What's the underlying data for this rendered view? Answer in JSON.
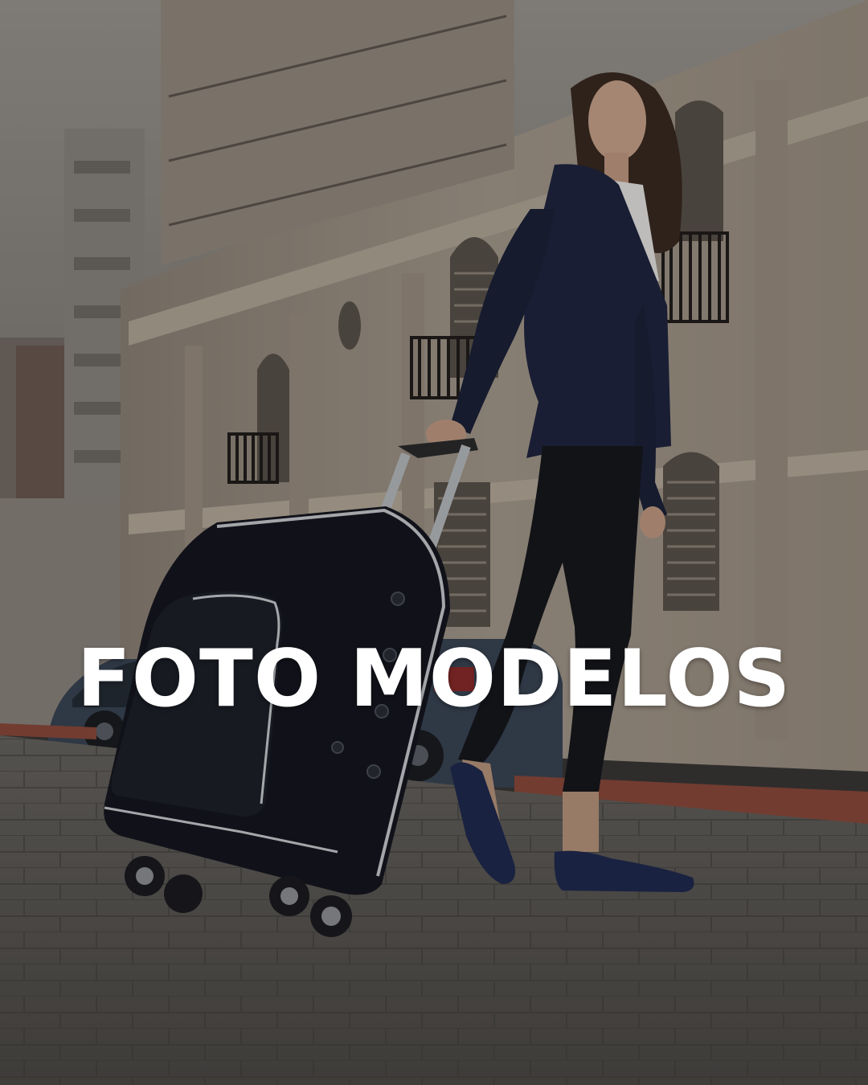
{
  "headline": "FOTO MODELOS",
  "colors": {
    "sky": "#8f8b86",
    "facade": "#a89c8e",
    "facade_shadow": "#7d7268",
    "pavement": "#5b5854",
    "jacket": "#1f2540",
    "suitcase": "#15171f",
    "text": "#ffffff"
  }
}
